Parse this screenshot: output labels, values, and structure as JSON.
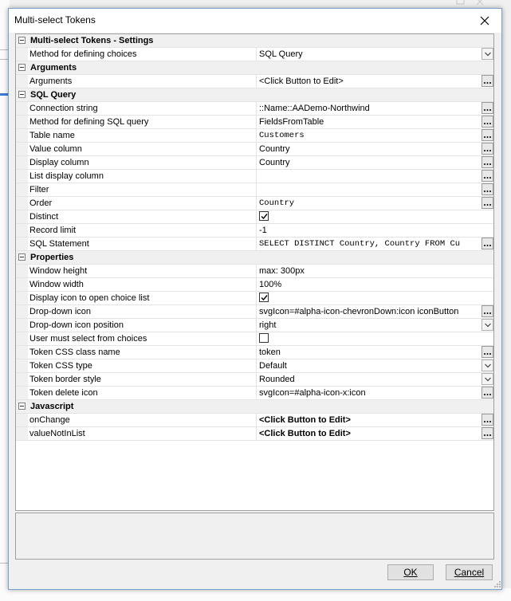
{
  "window": {
    "title": "Multi-select Tokens",
    "close_symbol": "✕"
  },
  "grid": {
    "rows": [
      {
        "type": "category",
        "label": "Multi-select Tokens - Settings"
      },
      {
        "type": "property",
        "label": "Method for defining choices",
        "value": "SQL Query",
        "control": "dropdown"
      },
      {
        "type": "category",
        "label": "Arguments"
      },
      {
        "type": "property",
        "label": "Arguments",
        "value": "<Click Button to Edit>",
        "control": "ellipsis"
      },
      {
        "type": "category",
        "label": "SQL Query"
      },
      {
        "type": "property",
        "label": "Connection string",
        "value": "::Name::AADemo-Northwind",
        "control": "ellipsis"
      },
      {
        "type": "property",
        "label": "Method for defining SQL query",
        "value": "FieldsFromTable",
        "control": "ellipsis"
      },
      {
        "type": "property",
        "label": "Table name",
        "value": "Customers",
        "control": "ellipsis",
        "mono": true
      },
      {
        "type": "property",
        "label": "Value column",
        "value": "Country",
        "control": "ellipsis"
      },
      {
        "type": "property",
        "label": "Display column",
        "value": "Country",
        "control": "ellipsis"
      },
      {
        "type": "property",
        "label": "List display column",
        "value": "",
        "control": "ellipsis"
      },
      {
        "type": "property",
        "label": "Filter",
        "value": "",
        "control": "ellipsis"
      },
      {
        "type": "property",
        "label": "Order",
        "value": "Country",
        "control": "ellipsis",
        "mono": true
      },
      {
        "type": "property",
        "label": "Distinct",
        "value": "checked",
        "control": "checkbox",
        "checked": true
      },
      {
        "type": "property",
        "label": "Record limit",
        "value": "-1",
        "control": "none"
      },
      {
        "type": "property",
        "label": "SQL Statement",
        "value": "SELECT DISTINCT Country, Country FROM Cu",
        "control": "ellipsis",
        "mono": true
      },
      {
        "type": "category",
        "label": "Properties"
      },
      {
        "type": "property",
        "label": "Window height",
        "value": "max: 300px",
        "control": "none"
      },
      {
        "type": "property",
        "label": "Window width",
        "value": "100%",
        "control": "none"
      },
      {
        "type": "property",
        "label": "Display icon to open choice list",
        "value": "checked",
        "control": "checkbox",
        "checked": true
      },
      {
        "type": "property",
        "label": "Drop-down icon",
        "value": "svgIcon=#alpha-icon-chevronDown:icon iconButton",
        "control": "ellipsis"
      },
      {
        "type": "property",
        "label": "Drop-down icon position",
        "value": "right",
        "control": "dropdown"
      },
      {
        "type": "property",
        "label": "User must select from choices",
        "value": "unchecked",
        "control": "checkbox",
        "checked": false
      },
      {
        "type": "property",
        "label": "Token CSS class name",
        "value": "token",
        "control": "ellipsis"
      },
      {
        "type": "property",
        "label": "Token CSS type",
        "value": "Default",
        "control": "dropdown"
      },
      {
        "type": "property",
        "label": "Token border style",
        "value": "Rounded",
        "control": "dropdown"
      },
      {
        "type": "property",
        "label": "Token delete icon",
        "value": "svgIcon=#alpha-icon-x:icon",
        "control": "ellipsis"
      },
      {
        "type": "category",
        "label": "Javascript"
      },
      {
        "type": "property",
        "label": "onChange",
        "value": "<Click Button to Edit>",
        "control": "ellipsis",
        "bold": true
      },
      {
        "type": "property",
        "label": "valueNotInList",
        "value": "<Click Button to Edit>",
        "control": "ellipsis",
        "bold": true
      }
    ]
  },
  "buttons": {
    "ok": "OK",
    "cancel": "Cancel"
  },
  "icons": {
    "close": "close-icon",
    "dropdown": "chevron-down-icon",
    "ellipsis": "ellipsis-icon",
    "checkmark": "checkmark-icon",
    "collapse": "minus-icon"
  },
  "colors": {
    "dialog_border": "#7a9fd1",
    "category_bg": "#f0f0f0",
    "grid_bg": "#ffffff"
  }
}
